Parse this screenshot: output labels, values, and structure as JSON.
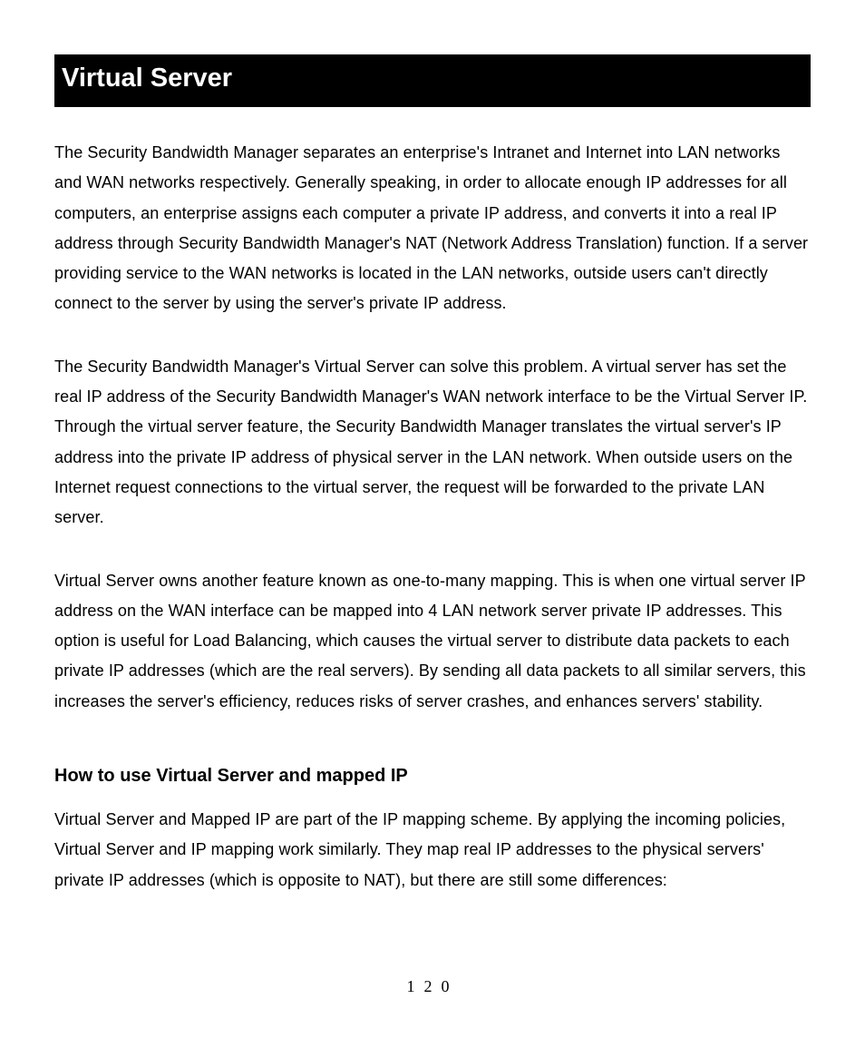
{
  "title": "Virtual Server",
  "paragraphs": {
    "p1": "The Security Bandwidth Manager separates an enterprise's Intranet and Internet into LAN networks and WAN networks respectively.    Generally speaking, in order to allocate enough IP addresses for all computers, an enterprise assigns each computer a private IP address, and converts it into a real IP address through Security Bandwidth Manager's NAT (Network Address Translation) function.    If a server providing service to the WAN networks is located in the LAN networks, outside users can't directly connect to the server by using the server's private IP address.",
    "p2": "The Security Bandwidth Manager's Virtual Server can solve this problem.    A virtual server has set the real IP address of the Security Bandwidth Manager's WAN network interface to be the Virtual Server IP. Through the virtual server feature, the Security Bandwidth Manager translates the virtual server's IP address into the private IP address of physical server in the LAN network. When outside users on the Internet request connections to the virtual server, the request will be forwarded to the private LAN server.",
    "p3": "Virtual Server owns another feature known as one-to-many mapping. This is when one virtual server IP address on the WAN interface can be mapped into 4 LAN network server private IP addresses. This option is useful for Load Balancing, which causes the virtual server to distribute data packets to each private IP addresses (which are the real servers).    By sending all data packets to all similar servers, this increases the server's efficiency, reduces risks of server crashes, and enhances servers' stability."
  },
  "subheading": "How to use Virtual Server and mapped IP",
  "paragraphs2": {
    "p4": "Virtual Server and Mapped IP are part of the IP mapping scheme. By applying the incoming policies, Virtual Server and IP mapping work similarly. They map real IP addresses to the physical servers' private IP addresses (which is opposite to NAT), but there are still some differences:"
  },
  "page_number": "120"
}
